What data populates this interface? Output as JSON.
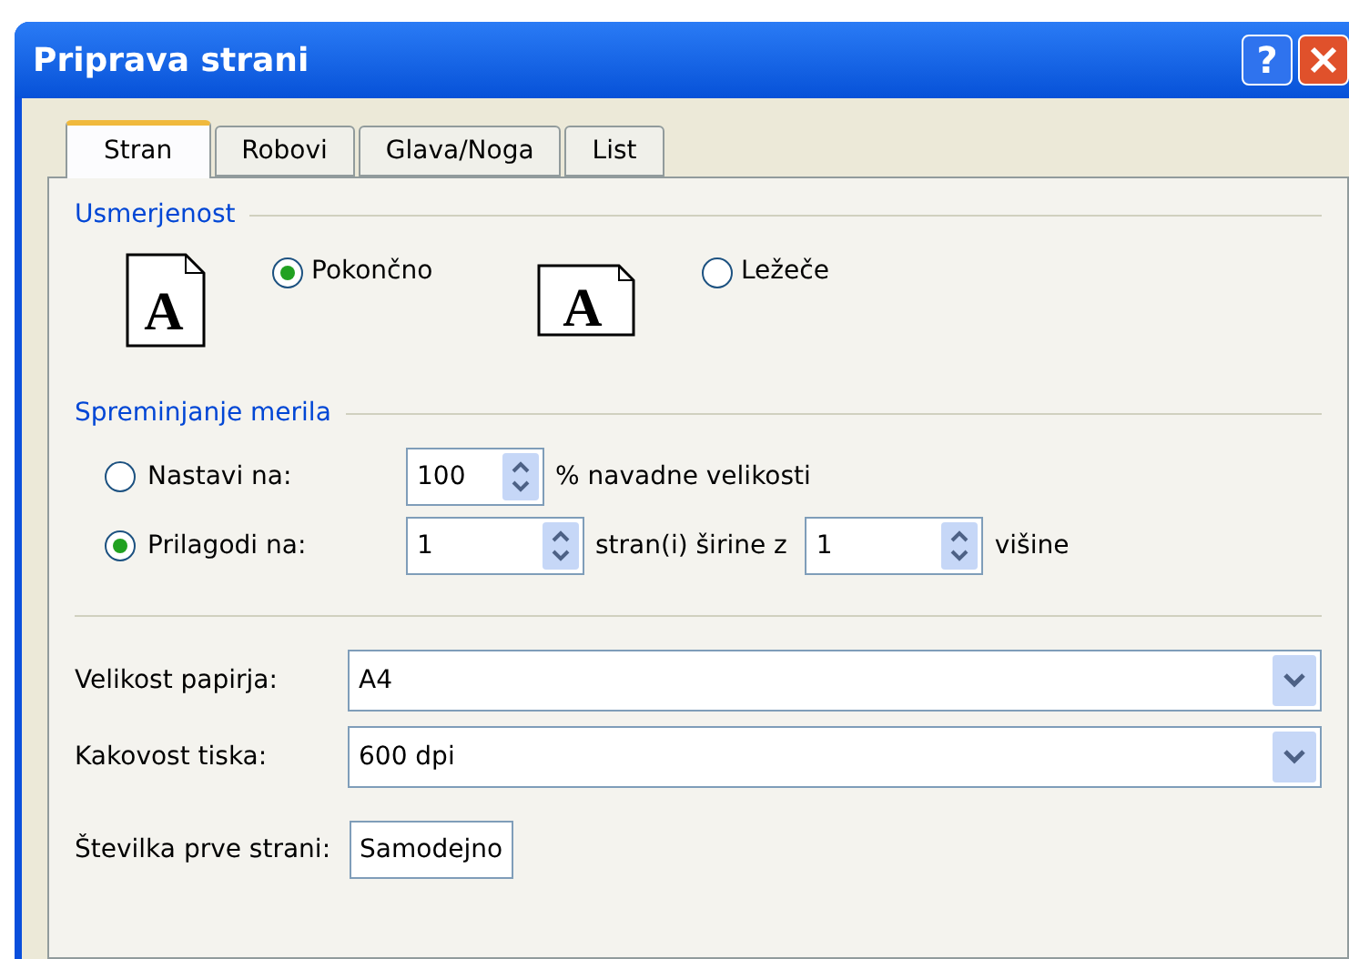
{
  "window": {
    "title": "Priprava strani",
    "buttons": [
      "?"
    ]
  },
  "tabs": [
    {
      "label": "Stran",
      "selected": true
    },
    {
      "label": "Robovi",
      "selected": false
    },
    {
      "label": "Glava/Noga",
      "selected": false
    },
    {
      "label": "List",
      "selected": false
    }
  ],
  "orientation": {
    "heading": "Usmerjenost",
    "options": [
      {
        "kind": "portrait",
        "icon_glyph": "A",
        "label": "Pokončno",
        "selected": true
      },
      {
        "kind": "landscape",
        "icon_glyph": "A",
        "label": "Ležeče",
        "selected": false
      }
    ]
  },
  "scaling": {
    "heading": "Spreminjanje merila",
    "adjust": {
      "label": "Nastavi na:",
      "selected": false,
      "value": "100",
      "suffix": "% navadne velikosti"
    },
    "fit": {
      "label": "Prilagodi na:",
      "selected": true,
      "wide_value": "1",
      "wide_suffix": "stran(i) širine z",
      "tall_value": "1",
      "tall_suffix": "višine"
    }
  },
  "paper_size": {
    "label": "Velikost papirja:",
    "value": "A4"
  },
  "print_quality": {
    "label": "Kakovost tiska:",
    "value": "600 dpi"
  },
  "first_page_number": {
    "label": "Številka prve strani:",
    "value": "Samodejno"
  }
}
